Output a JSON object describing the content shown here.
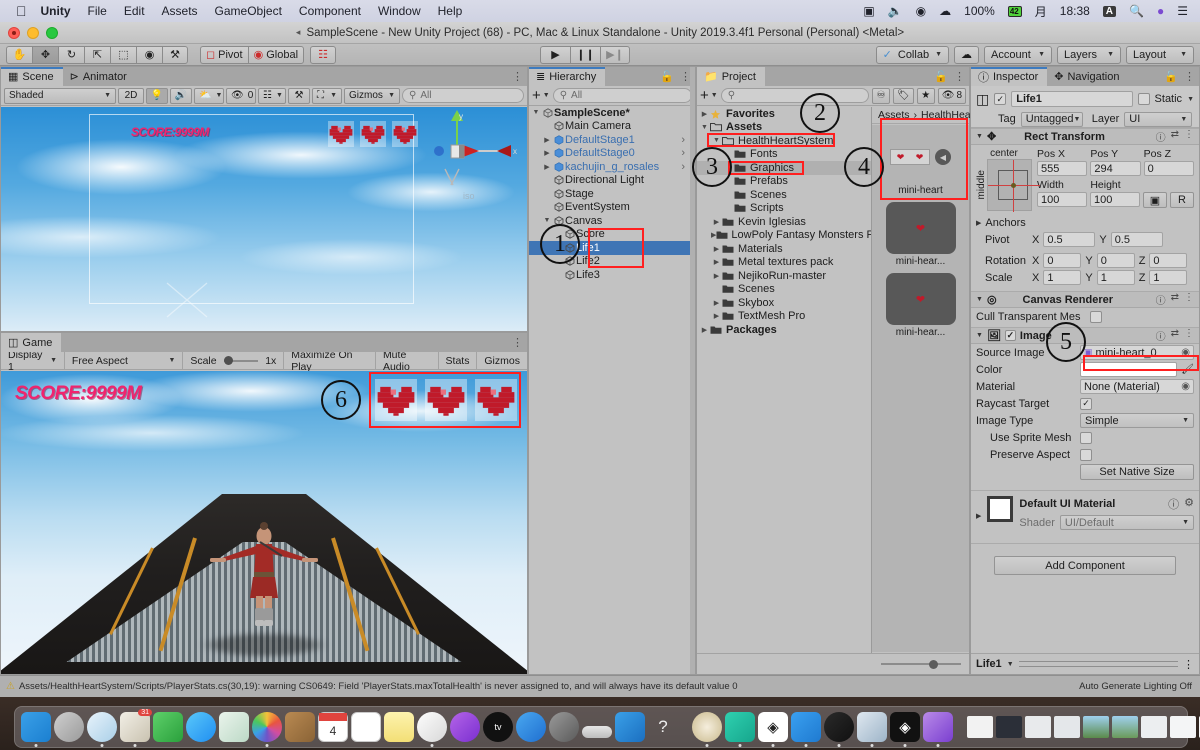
{
  "macos_menubar": {
    "apple_icon": "apple-icon",
    "items": [
      "Unity",
      "File",
      "Edit",
      "Assets",
      "GameObject",
      "Component",
      "Window",
      "Help"
    ],
    "status": {
      "screen_record_icon": "screen-record-icon",
      "volume_icon": "volume-icon",
      "podcast_icon": "podcast-icon",
      "cloud_icon": "cloud-icon",
      "battery_percent": "100%",
      "battery_icon": "battery-icon",
      "battery_value": "42",
      "day": "月",
      "time": "18:38",
      "input_source": "A",
      "search_icon": "search-icon",
      "siri_icon": "siri-icon",
      "control_center_icon": "control-center-icon"
    }
  },
  "window": {
    "back_icon": "collapse-icon",
    "title": "SampleScene - New Unity Project (68) - PC, Mac & Linux Standalone - Unity 2019.3.4f1 Personal (Personal) <Metal>"
  },
  "toolbar": {
    "tools": [
      {
        "name": "hand-tool",
        "glyph": "✋"
      },
      {
        "name": "move-tool",
        "glyph": "✥"
      },
      {
        "name": "rotate-tool",
        "glyph": "↻"
      },
      {
        "name": "scale-tool",
        "glyph": "⤡"
      },
      {
        "name": "rect-tool",
        "glyph": "⬚"
      },
      {
        "name": "transform-tool",
        "glyph": "✿"
      },
      {
        "name": "custom-tool",
        "glyph": "⚒"
      }
    ],
    "pivot_label": "Pivot",
    "global_label": "Global",
    "snap_label": "snap-icon",
    "play_label": "▶",
    "pause_label": "❙❙",
    "step_label": "▶❙",
    "collab_label": "Collab",
    "cloud_label": "cloud-icon",
    "account_label": "Account",
    "layers_label": "Layers",
    "layout_label": "Layout"
  },
  "scene_view": {
    "tabs": [
      {
        "label": "Scene",
        "icon": "scene-icon",
        "selected": true
      },
      {
        "label": "Animator",
        "icon": "animator-icon",
        "selected": false
      }
    ],
    "shading_mode": "Shaded",
    "mode_2d": "2D",
    "lighting_icon": "lighting-icon",
    "audio_icon": "audio-icon",
    "fx_icon": "fx-icon",
    "hidden_count": "0",
    "grid_icon": "grid-icon",
    "component_icon": "component-icon",
    "camera_icon": "camera-icon",
    "gizmos_label": "Gizmos",
    "search_placeholder": "All",
    "overlay": {
      "score_text": "SCORE:9999M",
      "hearts": 3
    },
    "axis_gizmo_labels": {
      "y": "y",
      "x": "x",
      "persp": "iso"
    }
  },
  "game_view": {
    "tab_label": "Game",
    "tab_icon": "game-icon",
    "display": "Display 1",
    "aspect": "Free Aspect",
    "scale_label": "Scale",
    "scale_value": "1x",
    "maximize_label": "Maximize On Play",
    "mute_label": "Mute Audio",
    "stats_label": "Stats",
    "gizmos_label": "Gizmos",
    "overlay": {
      "score_text": "SCORE:9999M",
      "hearts": 3
    }
  },
  "hierarchy": {
    "tab_label": "Hierarchy",
    "lock_icon": "lock-icon",
    "menu_icon": "kebab-icon",
    "add_label": "+",
    "search_placeholder": "All",
    "items": [
      {
        "label": "SampleScene*",
        "indent": 0,
        "icon": "scene-icon",
        "expand": "down",
        "style": "bold",
        "selected": false
      },
      {
        "label": "Main Camera",
        "indent": 1,
        "icon": "gameobject-icon",
        "expand": "none",
        "style": "normal",
        "selected": false
      },
      {
        "label": "DefaultStage1",
        "indent": 1,
        "icon": "prefab-icon",
        "expand": "right",
        "style": "prefab",
        "selected": false
      },
      {
        "label": "DefaultStage0",
        "indent": 1,
        "icon": "prefab-icon",
        "expand": "right",
        "style": "prefab",
        "selected": false
      },
      {
        "label": "kachujin_g_rosales",
        "indent": 1,
        "icon": "model-icon",
        "expand": "right",
        "style": "prefab",
        "selected": false
      },
      {
        "label": "Directional Light",
        "indent": 1,
        "icon": "gameobject-icon",
        "expand": "none",
        "style": "normal",
        "selected": false
      },
      {
        "label": "Stage",
        "indent": 1,
        "icon": "gameobject-icon",
        "expand": "none",
        "style": "normal",
        "selected": false
      },
      {
        "label": "EventSystem",
        "indent": 1,
        "icon": "gameobject-icon",
        "expand": "none",
        "style": "normal",
        "selected": false
      },
      {
        "label": "Canvas",
        "indent": 1,
        "icon": "gameobject-icon",
        "expand": "down",
        "style": "normal",
        "selected": false
      },
      {
        "label": "Score",
        "indent": 2,
        "icon": "gameobject-icon",
        "expand": "none",
        "style": "normal",
        "selected": false
      },
      {
        "label": "Life1",
        "indent": 2,
        "icon": "gameobject-icon",
        "expand": "none",
        "style": "normal",
        "selected": true
      },
      {
        "label": "Life2",
        "indent": 2,
        "icon": "gameobject-icon",
        "expand": "none",
        "style": "normal",
        "selected": false
      },
      {
        "label": "Life3",
        "indent": 2,
        "icon": "gameobject-icon",
        "expand": "none",
        "style": "normal",
        "selected": false
      }
    ]
  },
  "project": {
    "tab_label": "Project",
    "tab_icon": "folder-icon",
    "lock_icon": "lock-icon",
    "menu_icon": "kebab-icon",
    "add_label": "+",
    "search_placeholder": "",
    "filter_icons": [
      "type-filter-icon",
      "label-filter-icon",
      "favorite-filter-icon"
    ],
    "hidden_count": "8",
    "tree": [
      {
        "label": "Favorites",
        "indent": 0,
        "expand": "right",
        "icon": "star-icon",
        "bold": true,
        "selected": false
      },
      {
        "label": "Assets",
        "indent": 0,
        "expand": "down",
        "icon": "folder-open-icon",
        "bold": true,
        "selected": false
      },
      {
        "label": "HealthHeartSystem",
        "indent": 1,
        "expand": "down",
        "icon": "folder-open-icon",
        "bold": false,
        "selected": false
      },
      {
        "label": "Fonts",
        "indent": 2,
        "expand": "none",
        "icon": "folder-icon",
        "bold": false,
        "selected": false
      },
      {
        "label": "Graphics",
        "indent": 2,
        "expand": "none",
        "icon": "folder-icon",
        "bold": false,
        "selected": true
      },
      {
        "label": "Prefabs",
        "indent": 2,
        "expand": "none",
        "icon": "folder-icon",
        "bold": false,
        "selected": false
      },
      {
        "label": "Scenes",
        "indent": 2,
        "expand": "none",
        "icon": "folder-icon",
        "bold": false,
        "selected": false
      },
      {
        "label": "Scripts",
        "indent": 2,
        "expand": "none",
        "icon": "folder-icon",
        "bold": false,
        "selected": false
      },
      {
        "label": "Kevin Iglesias",
        "indent": 1,
        "expand": "right",
        "icon": "folder-icon",
        "bold": false,
        "selected": false
      },
      {
        "label": "LowPoly Fantasy Monsters F",
        "indent": 1,
        "expand": "right",
        "icon": "folder-icon",
        "bold": false,
        "selected": false
      },
      {
        "label": "Materials",
        "indent": 1,
        "expand": "right",
        "icon": "folder-icon",
        "bold": false,
        "selected": false
      },
      {
        "label": "Metal textures pack",
        "indent": 1,
        "expand": "right",
        "icon": "folder-icon",
        "bold": false,
        "selected": false
      },
      {
        "label": "NejikoRun-master",
        "indent": 1,
        "expand": "right",
        "icon": "folder-icon",
        "bold": false,
        "selected": false
      },
      {
        "label": "Scenes",
        "indent": 1,
        "expand": "none",
        "icon": "folder-icon",
        "bold": false,
        "selected": false
      },
      {
        "label": "Skybox",
        "indent": 1,
        "expand": "right",
        "icon": "folder-icon",
        "bold": false,
        "selected": false
      },
      {
        "label": "TextMesh Pro",
        "indent": 1,
        "expand": "right",
        "icon": "folder-icon",
        "bold": false,
        "selected": false
      },
      {
        "label": "Packages",
        "indent": 0,
        "expand": "right",
        "icon": "folder-icon",
        "bold": true,
        "selected": false
      }
    ],
    "breadcrumb": [
      "Assets",
      "HealthHea"
    ],
    "grid_items": [
      {
        "label": "mini-heart",
        "kind": "sprite-sheet",
        "selected": true
      },
      {
        "label": "mini-hear...",
        "kind": "sprite",
        "selected": false
      },
      {
        "label": "mini-hear...",
        "kind": "sprite",
        "selected": false
      }
    ],
    "zoom_slider": "60"
  },
  "inspector": {
    "tabs": [
      {
        "label": "Inspector",
        "icon": "info-icon",
        "selected": true
      },
      {
        "label": "Navigation",
        "icon": "navigation-icon",
        "selected": false
      }
    ],
    "lock_icon": "lock-icon",
    "menu_icon": "kebab-icon",
    "object_name": "Life1",
    "object_enabled": true,
    "static_label": "Static",
    "tag_label": "Tag",
    "tag_value": "Untagged",
    "layer_label": "Layer",
    "layer_value": "UI",
    "rect_transform": {
      "title": "Rect Transform",
      "anchor_preset_h": "center",
      "anchor_preset_v": "middle",
      "fields": [
        {
          "label": "Pos X",
          "value": "555"
        },
        {
          "label": "Pos Y",
          "value": "294"
        },
        {
          "label": "Pos Z",
          "value": "0"
        },
        {
          "label": "Width",
          "value": "100"
        },
        {
          "label": "Height",
          "value": "100"
        }
      ],
      "blueprint_icon": "blueprint-icon",
      "raw_label": "R",
      "anchors_label": "Anchors",
      "pivot_label": "Pivot",
      "pivot_x": "0.5",
      "pivot_y": "0.5",
      "rotation_label": "Rotation",
      "rotation_x": "0",
      "rotation_y": "0",
      "rotation_z": "0",
      "scale_label": "Scale",
      "scale_x": "1",
      "scale_y": "1",
      "scale_z": "1"
    },
    "canvas_renderer": {
      "title": "Canvas Renderer",
      "cull_label": "Cull Transparent Mes",
      "cull_checked": false
    },
    "image": {
      "title": "Image",
      "enabled": true,
      "source_image_label": "Source Image",
      "source_image_value": "mini-heart_0",
      "color_label": "Color",
      "color_value": "#FFFFFF",
      "material_label": "Material",
      "material_value": "None (Material)",
      "raycast_label": "Raycast Target",
      "raycast_checked": true,
      "image_type_label": "Image Type",
      "image_type_value": "Simple",
      "use_sprite_mesh_label": "Use Sprite Mesh",
      "use_sprite_mesh_checked": false,
      "preserve_aspect_label": "Preserve Aspect",
      "preserve_aspect_checked": false,
      "set_native_size_label": "Set Native Size"
    },
    "material": {
      "title": "Default UI Material",
      "shader_label": "Shader",
      "shader_value": "UI/Default",
      "help_icon": "help-icon",
      "gear_icon": "gear-icon"
    },
    "add_component_label": "Add Component",
    "footer_object": "Life1"
  },
  "status_bar": {
    "warning_icon": "warning-icon",
    "message": "Assets/HealthHeartSystem/Scripts/PlayerStats.cs(30,19): warning CS0649: Field 'PlayerStats.maxTotalHealth' is never assigned to, and will always have its default value 0",
    "lighting": "Auto Generate Lighting Off"
  },
  "annotations": [
    {
      "number": "1",
      "target": "hierarchy-life-items"
    },
    {
      "number": "2",
      "target": "project-healthheartsystem-folder"
    },
    {
      "number": "3",
      "target": "project-graphics-folder"
    },
    {
      "number": "4",
      "target": "project-mini-heart-asset"
    },
    {
      "number": "5",
      "target": "inspector-source-image"
    },
    {
      "number": "6",
      "target": "game-view-hearts"
    }
  ],
  "colors": {
    "accent_red": "#ff1f1f",
    "selection_blue": "#3f75b5",
    "score_pink": "#f0246e",
    "heart_red": "#c01a2a",
    "panel_gray": "#c2c2c2"
  },
  "dock": {
    "apps": [
      "finder-icon",
      "launchpad-icon",
      "safari-icon",
      "photos-legacy-icon",
      "facetime-icon",
      "messages-icon",
      "maps-icon",
      "photos-icon",
      "contacts-icon",
      "calendar-icon",
      "reminders-icon",
      "notes-icon",
      "music-icon",
      "podcasts-icon",
      "appletv-icon",
      "appstore-icon",
      "system-preferences-icon",
      "terminal-icon",
      "xcode-icon",
      "help-icon"
    ],
    "running": [
      "unity-hub-icon",
      "sketch-icon",
      "unity-icon",
      "zoom-icon",
      "quicklook-icon",
      "preview-icon",
      "unity-dark-icon",
      "visual-studio-icon"
    ],
    "minimized_count": 13,
    "trash_icon": "trash-icon"
  }
}
